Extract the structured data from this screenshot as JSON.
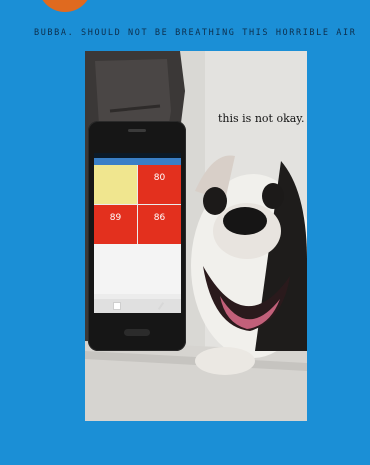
{
  "caption": "BUBBA. SHOULD NOT BE BREATHING THIS HORRIBLE AIR",
  "photo": {
    "overlay_text": "this is not okay.",
    "phone": {
      "status_text": "",
      "tabs": [
        "",
        ""
      ],
      "tiles": [
        {
          "value": "",
          "label": "",
          "color": "#f0e68f"
        },
        {
          "value": "80",
          "label": "",
          "color": "#e3301e"
        },
        {
          "value": "89",
          "label": "",
          "color": "#e3301e"
        },
        {
          "value": "86",
          "label": "",
          "color": "#e3301e"
        }
      ]
    }
  },
  "colors": {
    "background": "#1b8fd6",
    "accent": "#e06a1f"
  }
}
